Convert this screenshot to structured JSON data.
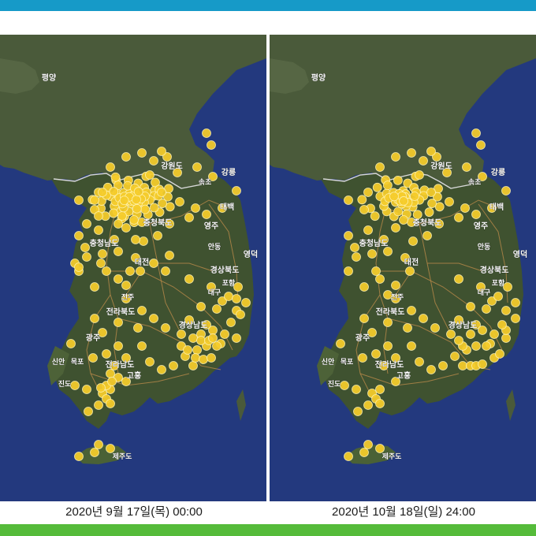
{
  "colors": {
    "top_bar": "#169ac8",
    "bottom_bar": "#55bb3a",
    "sea": "#23397e",
    "land": "#4a5a3a",
    "dot": "#f6cd2b",
    "dot_edge": "#fff3b0"
  },
  "icons": {
    "place_marker": "dot-marker"
  },
  "map_labels": {
    "pyongyang": "평양",
    "gangwon": "강원도",
    "gangneung": "강릉",
    "chungbuk": "충청북도",
    "chungnam": "충청남도",
    "gyeongbuk": "경상북도",
    "jeonbuk": "전라북도",
    "gyeongnam": "경상남도",
    "jeonnam": "전라남도",
    "jeju": "제주도",
    "taebaek": "태백",
    "yeongju": "영주",
    "andong": "안동",
    "yeongdeok": "영덕",
    "pohang": "포항",
    "daejeon": "대전",
    "jeonju": "전주",
    "daegu": "대구",
    "gwangju": "광주",
    "sinan": "신안",
    "mokpo": "목포",
    "jindo": "진도",
    "goheung": "고흥",
    "sokcho": "속초"
  },
  "panels": [
    {
      "caption": "2020년 9월 17일(목) 00:00",
      "cluster_count_level": "high"
    },
    {
      "caption": "2020년 10월 18일(일) 24:00",
      "cluster_count_level": "moderate"
    }
  ]
}
